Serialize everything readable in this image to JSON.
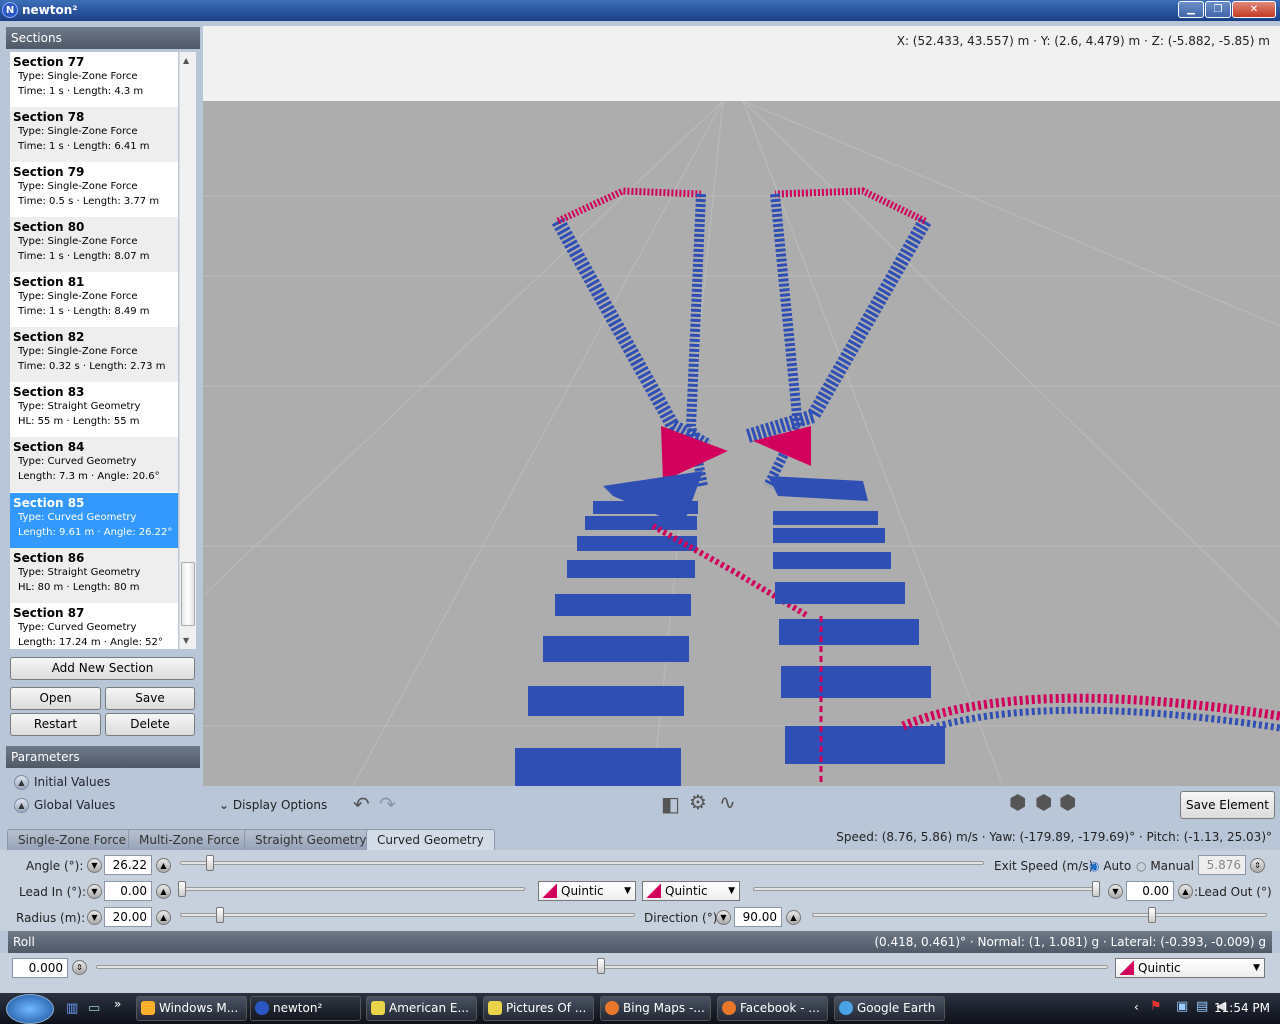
{
  "window": {
    "title": "newton²",
    "logo": "N"
  },
  "sections_header": "Sections",
  "sections": [
    {
      "title": "Section 77",
      "type": "Type: Single-Zone Force",
      "info": "Time: 1 s · Length: 4.3 m"
    },
    {
      "title": "Section 78",
      "type": "Type: Single-Zone Force",
      "info": "Time: 1 s · Length: 6.41 m"
    },
    {
      "title": "Section 79",
      "type": "Type: Single-Zone Force",
      "info": "Time: 0.5 s · Length: 3.77 m"
    },
    {
      "title": "Section 80",
      "type": "Type: Single-Zone Force",
      "info": "Time: 1 s · Length: 8.07 m"
    },
    {
      "title": "Section 81",
      "type": "Type: Single-Zone Force",
      "info": "Time: 1 s · Length: 8.49 m"
    },
    {
      "title": "Section 82",
      "type": "Type: Single-Zone Force",
      "info": "Time: 0.32 s · Length: 2.73 m"
    },
    {
      "title": "Section 83",
      "type": "Type: Straight Geometry",
      "info": "HL: 55 m · Length: 55 m"
    },
    {
      "title": "Section 84",
      "type": "Type: Curved Geometry",
      "info": "Length: 7.3 m · Angle: 20.6°"
    },
    {
      "title": "Section 85",
      "type": "Type: Curved Geometry",
      "info": "Length: 9.61 m · Angle: 26.22°"
    },
    {
      "title": "Section 86",
      "type": "Type: Straight Geometry",
      "info": "HL: 80 m · Length: 80 m"
    },
    {
      "title": "Section 87",
      "type": "Type: Curved Geometry",
      "info": "Length: 17.24 m · Angle: 52°"
    }
  ],
  "buttons": {
    "add": "Add New Section",
    "open": "Open",
    "save": "Save",
    "restart": "Restart",
    "delete": "Delete",
    "save_element": "Save Element"
  },
  "parameters_header": "Parameters",
  "parameters": {
    "initial": "Initial Values",
    "global": "Global Values"
  },
  "coords": "X: (52.433, 43.557) m · Y: (2.6, 4.479) m · Z: (-5.882, -5.85) m",
  "display_options": "Display Options",
  "tabs": [
    "Single-Zone Force",
    "Multi-Zone Force",
    "Straight Geometry",
    "Curved Geometry"
  ],
  "speed": "Speed: (8.76, 5.86) m/s · Yaw: (-179.89, -179.69)° · Pitch: (-1.13, 25.03)°",
  "controls": {
    "angle_label": "Angle (°):",
    "angle": "26.22",
    "exit_speed_label": "Exit Speed (m/s):",
    "auto": "Auto",
    "manual": "Manual",
    "exit_speed": "5.876",
    "lead_in_label": "Lead In (°):",
    "lead_in": "0.00",
    "interp_in": "Quintic",
    "interp_out": "Quintic",
    "lead_out": "0.00",
    "lead_out_label": ":Lead Out (°)",
    "radius_label": "Radius (m):",
    "radius": "20.00",
    "direction_label": "Direction (°):",
    "direction": "90.00"
  },
  "roll": {
    "label": "Roll",
    "readout": "(0.418, 0.461)° · Normal: (1, 1.081) g · Lateral: (-0.393, -0.009) g",
    "value": "0.000",
    "interp": "Quintic"
  },
  "taskbar": {
    "items": [
      "Windows M...",
      "newton²",
      "American E...",
      "Pictures Of ...",
      "Bing Maps -...",
      "Facebook - ...",
      "Google Earth"
    ],
    "clock": "11:54 PM"
  },
  "colors": {
    "track_blue": "#2f4fb5",
    "track_pink": "#d1005a",
    "selection": "#3399ff"
  }
}
